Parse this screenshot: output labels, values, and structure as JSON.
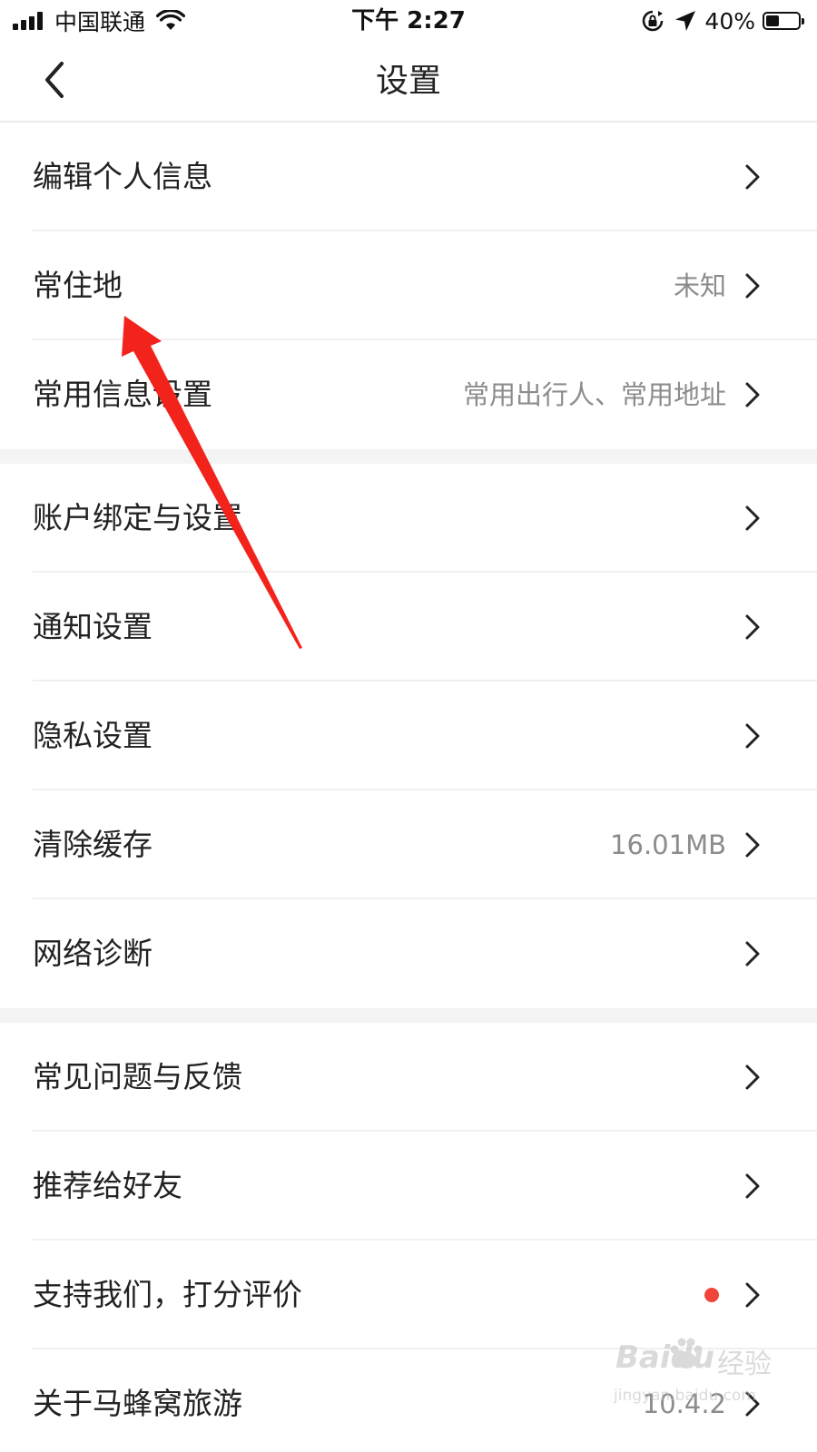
{
  "status_bar": {
    "carrier": "中国联通",
    "time": "下午 2:27",
    "battery": "40%",
    "battery_level": 0.4,
    "icons": [
      "signal-icon",
      "wifi-icon",
      "orientation-lock-icon",
      "location-icon",
      "battery-icon"
    ]
  },
  "nav": {
    "title": "设置",
    "back_icon": "chevron-left-icon"
  },
  "sections": [
    {
      "items": [
        {
          "label": "编辑个人信息",
          "value": ""
        },
        {
          "label": "常住地",
          "value": "未知"
        },
        {
          "label": "常用信息设置",
          "value": "常用出行人、常用地址"
        }
      ]
    },
    {
      "items": [
        {
          "label": "账户绑定与设置",
          "value": ""
        },
        {
          "label": "通知设置",
          "value": ""
        },
        {
          "label": "隐私设置",
          "value": ""
        },
        {
          "label": "清除缓存",
          "value": "16.01MB"
        },
        {
          "label": "网络诊断",
          "value": ""
        }
      ]
    },
    {
      "items": [
        {
          "label": "常见问题与反馈",
          "value": ""
        },
        {
          "label": "推荐给好友",
          "value": ""
        },
        {
          "label": "支持我们，打分评价",
          "value": "",
          "badge": "red-dot"
        },
        {
          "label": "关于马蜂窝旅游",
          "value": "10.4.2"
        }
      ]
    }
  ],
  "colors": {
    "text": "#222222",
    "secondary_text": "#8c8c8c",
    "divider": "#f0f0f0",
    "section_gap": "#f4f4f4",
    "badge": "#f0453a",
    "annotation_arrow": "#f2231b"
  },
  "watermark": {
    "brand": "Baidu",
    "brand_cn": "经验",
    "url": "jingyan.baidu.com"
  }
}
